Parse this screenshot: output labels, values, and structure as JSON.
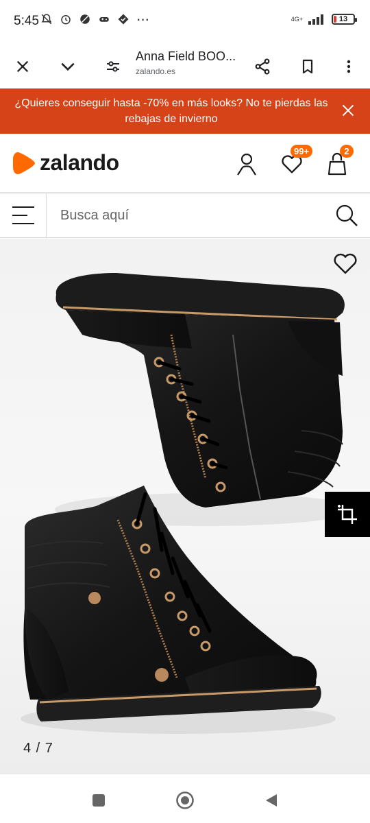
{
  "status_bar": {
    "time": "5:45",
    "network_top": "4G+",
    "battery_level": "13",
    "battery_fraction": 0.13,
    "icons": [
      "mute-alarm-icon",
      "alarm-icon",
      "no-disturb-icon",
      "game-controller-icon",
      "app-notification-icon",
      "more-dots-icon"
    ],
    "overflow_dots": "···"
  },
  "browser_toolbar": {
    "page_title": "Anna Field BOO...",
    "domain": "zalando.es",
    "icons": [
      "close-icon",
      "chevron-down-icon",
      "site-settings-icon",
      "share-icon",
      "bookmark-icon",
      "more-vert-icon"
    ]
  },
  "promo": {
    "text": "¿Quieres conseguir hasta -70% en más looks? No te pierdas las rebajas de invierno",
    "background": "#d74319"
  },
  "brand": {
    "logo_text": "zalando",
    "accent": "#ff6900",
    "wishlist_badge": "99+",
    "cart_badge": "2"
  },
  "search": {
    "placeholder": "Busca aquí"
  },
  "gallery": {
    "counter": "4 / 7"
  },
  "nav": {
    "icons": [
      "recent-apps-icon",
      "home-icon",
      "back-icon"
    ]
  }
}
